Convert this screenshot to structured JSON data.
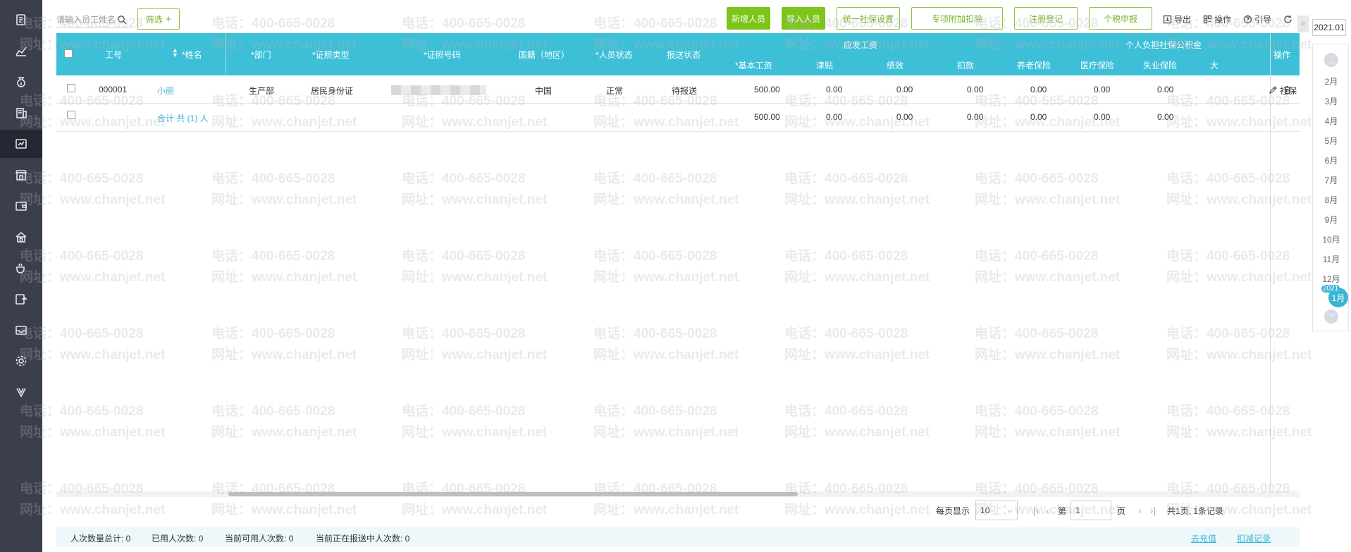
{
  "sidebar": {
    "icons": [
      "document-icon",
      "chart-icon",
      "money-bag-icon",
      "building-icon",
      "payroll-icon",
      "store-icon",
      "wallet-icon",
      "home-icon",
      "coffee-cup-icon",
      "transfer-icon",
      "inbox-icon",
      "settings-icon",
      "v-logo-icon"
    ],
    "active_index": 4
  },
  "toolbar": {
    "search_placeholder": "请输入员工姓名",
    "filter_label": "筛选",
    "buttons": {
      "add_person": "新增人员",
      "import_person": "导入人员",
      "unified_social_security": "统一社保设置",
      "special_deduction": "专项附加扣除",
      "registration": "注册登记",
      "tax_declaration": "个税申报"
    },
    "export_label": "导出",
    "operation_label": "操作",
    "guide_label": "引导"
  },
  "table": {
    "headers": {
      "id": "工号",
      "name": "*姓名",
      "dept": "*部门",
      "id_type": "*证照类型",
      "id_number": "*证照号码",
      "nationality": "国籍（地区）",
      "person_status": "*人员状态",
      "report_status": "报送状态",
      "wages_group": "应发工资",
      "base_salary": "*基本工资",
      "allowance": "津贴",
      "performance": "绩效",
      "deduction": "扣款",
      "social_group": "个人负担社保公积金",
      "pension": "养老保险",
      "medical": "医疗保险",
      "unemployment": "失业保险",
      "clipped": "大",
      "actions": "操作"
    },
    "rows": [
      {
        "id": "000001",
        "name": "小丽",
        "dept": "生产部",
        "id_type": "居民身份证",
        "nationality": "中国",
        "person_status": "正常",
        "report_status": "待报送",
        "base_salary": "500.00",
        "allowance": "0.00",
        "performance": "0.00",
        "deduction": "0.00",
        "pension": "0.00",
        "medical": "0.00",
        "unemployment": "0.00",
        "action_text": "社保"
      }
    ],
    "total": {
      "label": "合计 共 (1) 人",
      "base_salary": "500.00",
      "allowance": "0.00",
      "performance": "0.00",
      "deduction": "0.00",
      "pension": "0.00",
      "medical": "0.00",
      "unemployment": "0.00"
    }
  },
  "pagination": {
    "per_page_label": "每页显示",
    "per_page_value": "10",
    "page_prefix": "第",
    "page_value": "1",
    "page_suffix": "页",
    "summary": "共1页, 1条记录"
  },
  "status_bar": {
    "total_count": "人次数量总计: 0",
    "used_count": "已用人次数: 0",
    "available_count": "当前可用人次数: 0",
    "reporting_count": "当前正在报送中人次数: 0",
    "recharge": "去充值",
    "deduction_record": "扣减记录"
  },
  "month_picker": {
    "current": "2021.01",
    "months": [
      "2月",
      "3月",
      "4月",
      "5月",
      "6月",
      "7月",
      "8月",
      "9月",
      "10月",
      "11月",
      "12月"
    ],
    "active_year": "2021",
    "active_month": "1月"
  },
  "watermark": {
    "phone": "电话：400-665-0028",
    "site": "网址：www.chanjet.net"
  },
  "colors": {
    "header_teal": "#3dbfd8",
    "accent_green": "#7cc519",
    "sidebar_bg": "#3b3f4d",
    "link_teal": "#3cb5d5"
  }
}
